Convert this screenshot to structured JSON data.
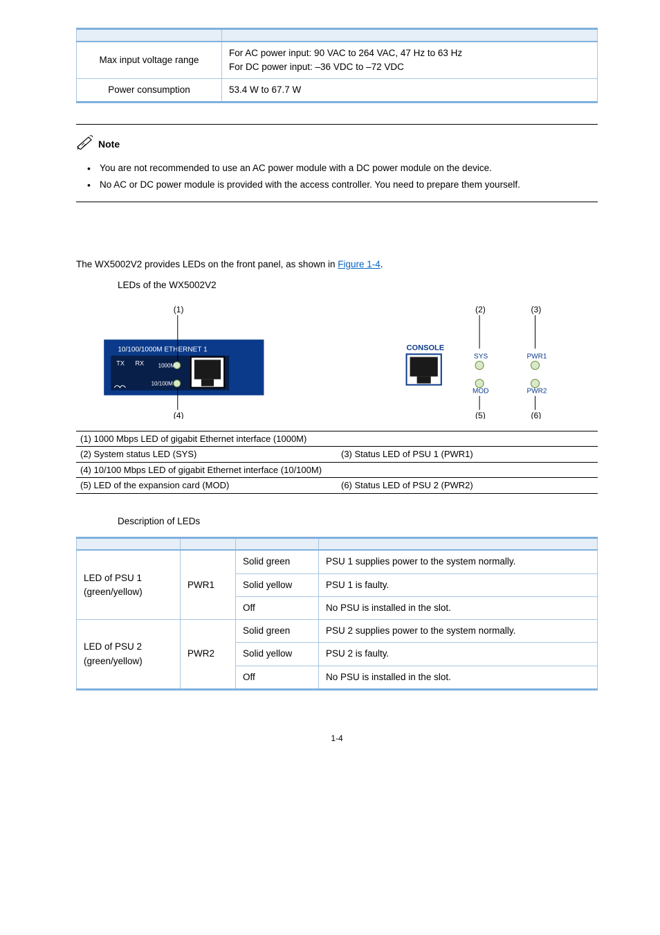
{
  "specTable": {
    "row1": {
      "label": "Max input voltage range",
      "value_line1": "For AC power input: 90 VAC to 264 VAC, 47 Hz to 63 Hz",
      "value_line2": "For DC power input: –36 VDC to –72 VDC"
    },
    "row2": {
      "label": "Power consumption",
      "value": "53.4 W to 67.7 W"
    }
  },
  "note": {
    "label": "Note",
    "bullet1": "You are not recommended to use an AC power module with a DC power module on the device.",
    "bullet2": "No AC or DC power module is provided with the access controller. You need to prepare them yourself."
  },
  "bodyText": {
    "prefix": "The WX5002V2 provides LEDs on the front panel, as shown in ",
    "link": "Figure 1-4",
    "suffix": "."
  },
  "figCaption": "LEDs of the WX5002V2",
  "diagram": {
    "portLabel": "10/100/1000M ETHERNET 1",
    "tx": "TX",
    "rx": "RX",
    "m1000": "1000M",
    "m10100": "10/100M",
    "console": "CONSOLE",
    "sys": "SYS",
    "mod": "MOD",
    "pwr1": "PWR1",
    "pwr2": "PWR2",
    "n1": "(1)",
    "n2": "(2)",
    "n3": "(3)",
    "n4": "(4)",
    "n5": "(5)",
    "n6": "(6)"
  },
  "callout": {
    "c1": "(1) 1000 Mbps LED of gigabit Ethernet interface (1000M)",
    "c2": "(2) System status LED (SYS)",
    "c3": "(3) Status LED of PSU 1 (PWR1)",
    "c4": "(4) 10/100 Mbps LED of gigabit Ethernet interface (10/100M)",
    "c5": "(5) LED of the expansion card (MOD)",
    "c6": "(6) Status LED of PSU 2 (PWR2)"
  },
  "ledTableCaption": "Description of LEDs",
  "ledTable": {
    "group1": {
      "name": "LED of PSU 1\n(green/yellow)",
      "mark": "PWR1",
      "r1s": "Solid green",
      "r1d": "PSU 1 supplies power to the system normally.",
      "r2s": "Solid yellow",
      "r2d": "PSU 1 is faulty.",
      "r3s": "Off",
      "r3d": "No PSU is installed in the slot."
    },
    "group2": {
      "name": "LED of PSU 2\n(green/yellow)",
      "mark": "PWR2",
      "r1s": "Solid green",
      "r1d": "PSU 2 supplies power to the system normally.",
      "r2s": "Solid yellow",
      "r2d": "PSU 2 is faulty.",
      "r3s": "Off",
      "r3d": "No PSU is installed in the slot."
    }
  },
  "pageNum": "1-4"
}
